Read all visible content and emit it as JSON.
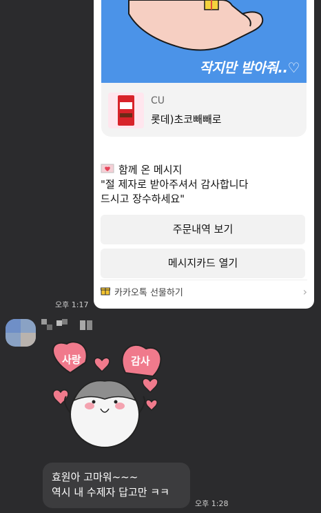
{
  "gift_card": {
    "banner_text": "작지만 받아줘..♡",
    "product": {
      "brand": "CU",
      "name": "롯데)초코빼빼로"
    },
    "message": {
      "title": "함께 온 메시지",
      "line1": "\"절 제자로 받아주셔서 감사합니다",
      "line2": "드시고 장수하세요\""
    },
    "buttons": {
      "order_history": "주문내역 보기",
      "message_card": "메시지카드 열기"
    },
    "footer": {
      "label": "카카오톡 선물하기"
    }
  },
  "timestamps": {
    "gift_time": "오후 1:17",
    "message_time": "오후 1:28"
  },
  "sticker": {
    "left_heart_text": "사랑",
    "right_heart_text": "감사"
  },
  "chat": {
    "line1": "효원아 고마워~~~",
    "line2": "역시 내 수제자 답고만 ㅋㅋ"
  },
  "colors": {
    "background": "#2b2b2d",
    "banner_blue": "#4b93e8",
    "heart_pink": "#f07a8c"
  }
}
